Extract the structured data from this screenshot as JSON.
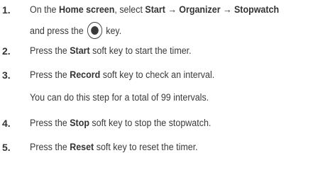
{
  "steps": [
    {
      "number": "1.",
      "pre": "On the ",
      "home": "Home screen",
      "mid": ", select ",
      "path": "Start → Organizer → Stopwatch",
      "cont_pre": "and press the ",
      "key_icon": "center-select-key-icon",
      "cont_post": " key."
    },
    {
      "number": "2.",
      "pre": "Press the ",
      "key": "Start",
      "post": " soft key to start the timer."
    },
    {
      "number": "3.",
      "pre": "Press the ",
      "key": "Record",
      "post": " soft key to check an interval.",
      "note": "You can do this step for a total of 99 intervals."
    },
    {
      "number": "4.",
      "pre": "Press the ",
      "key": "Stop",
      "post": " soft key to stop the stopwatch."
    },
    {
      "number": "5.",
      "pre": "Press the ",
      "key": "Reset",
      "post": " soft key to reset the timer."
    }
  ]
}
